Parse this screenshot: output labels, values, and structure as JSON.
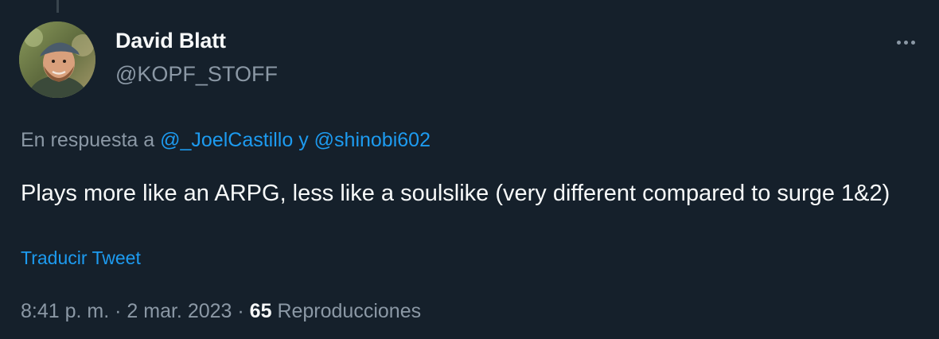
{
  "tweet": {
    "author_name": "David Blatt",
    "author_handle": "@KOPF_STOFF",
    "more_icon": "more-horizontal-icon",
    "reply_prefix": "En respuesta a",
    "reply_mentions": [
      "@_JoelCastillo",
      "@shinobi602"
    ],
    "reply_joiner": "y",
    "text": "Plays more like an ARPG, less like a soulslike (very different compared to surge 1&2)",
    "translate_label": "Traducir Tweet",
    "time": "8:41 p. m.",
    "date": "2 mar. 2023",
    "meta_separator": "·",
    "views_count": "65",
    "views_label": "Reproducciones"
  },
  "colors": {
    "background": "#15202b",
    "primary_text": "#f7f9f9",
    "secondary_text": "#8b98a5",
    "accent": "#1d9bf0"
  }
}
